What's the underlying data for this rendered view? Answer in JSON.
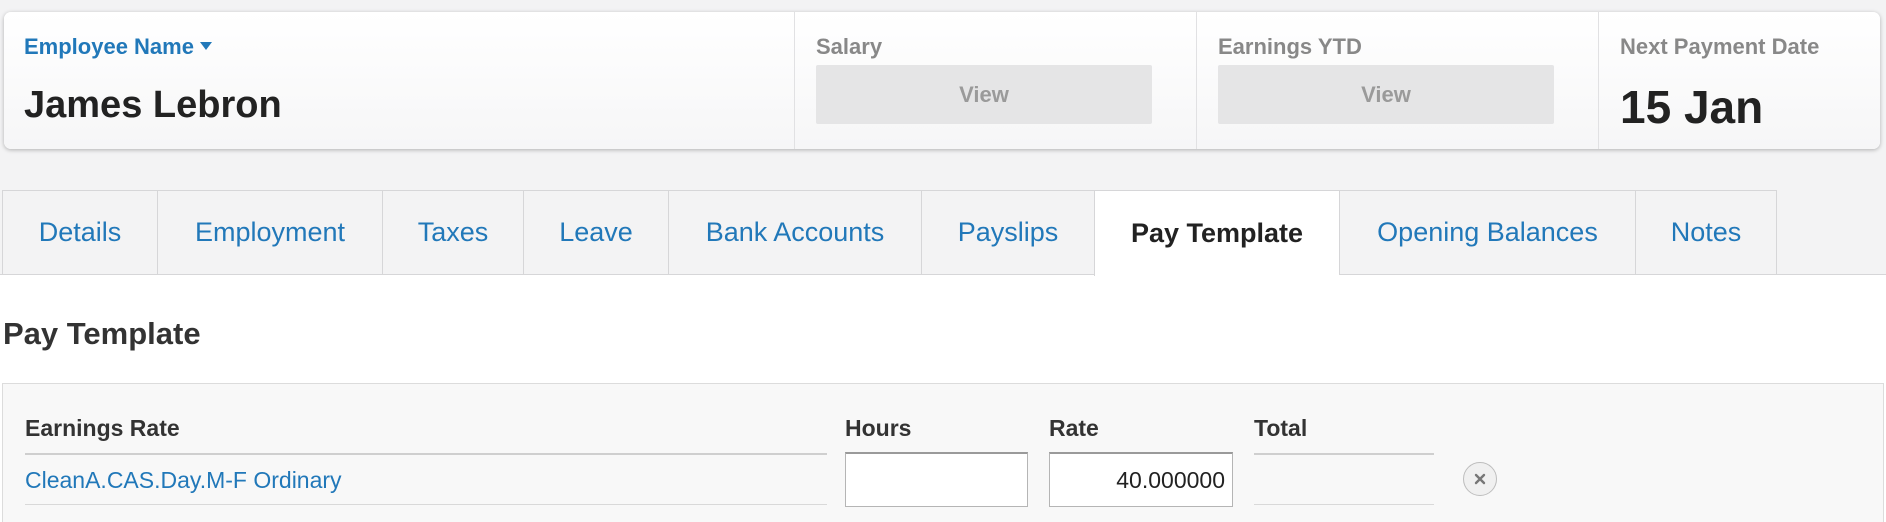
{
  "header": {
    "employee_label": "Employee Name",
    "employee_name": "James Lebron",
    "salary_label": "Salary",
    "salary_button": "View",
    "earnings_label": "Earnings YTD",
    "earnings_button": "View",
    "next_payment_label": "Next Payment Date",
    "next_payment_date": "15 Jan"
  },
  "tabs": [
    {
      "label": "Details"
    },
    {
      "label": "Employment"
    },
    {
      "label": "Taxes"
    },
    {
      "label": "Leave"
    },
    {
      "label": "Bank Accounts"
    },
    {
      "label": "Payslips"
    },
    {
      "label": "Pay Template",
      "active": true
    },
    {
      "label": "Opening Balances"
    },
    {
      "label": "Notes"
    }
  ],
  "section_title": "Pay Template",
  "pay_template": {
    "columns": {
      "earnings_rate": "Earnings Rate",
      "hours": "Hours",
      "rate": "Rate",
      "total": "Total"
    },
    "rows": [
      {
        "earnings_rate": "CleanA.CAS.Day.M-F Ordinary",
        "hours": "",
        "rate": "40.000000",
        "total": ""
      }
    ]
  },
  "colors": {
    "link": "#2178b9",
    "text": "#333333",
    "muted": "#888888",
    "page_bg": "#f3f3f4"
  }
}
